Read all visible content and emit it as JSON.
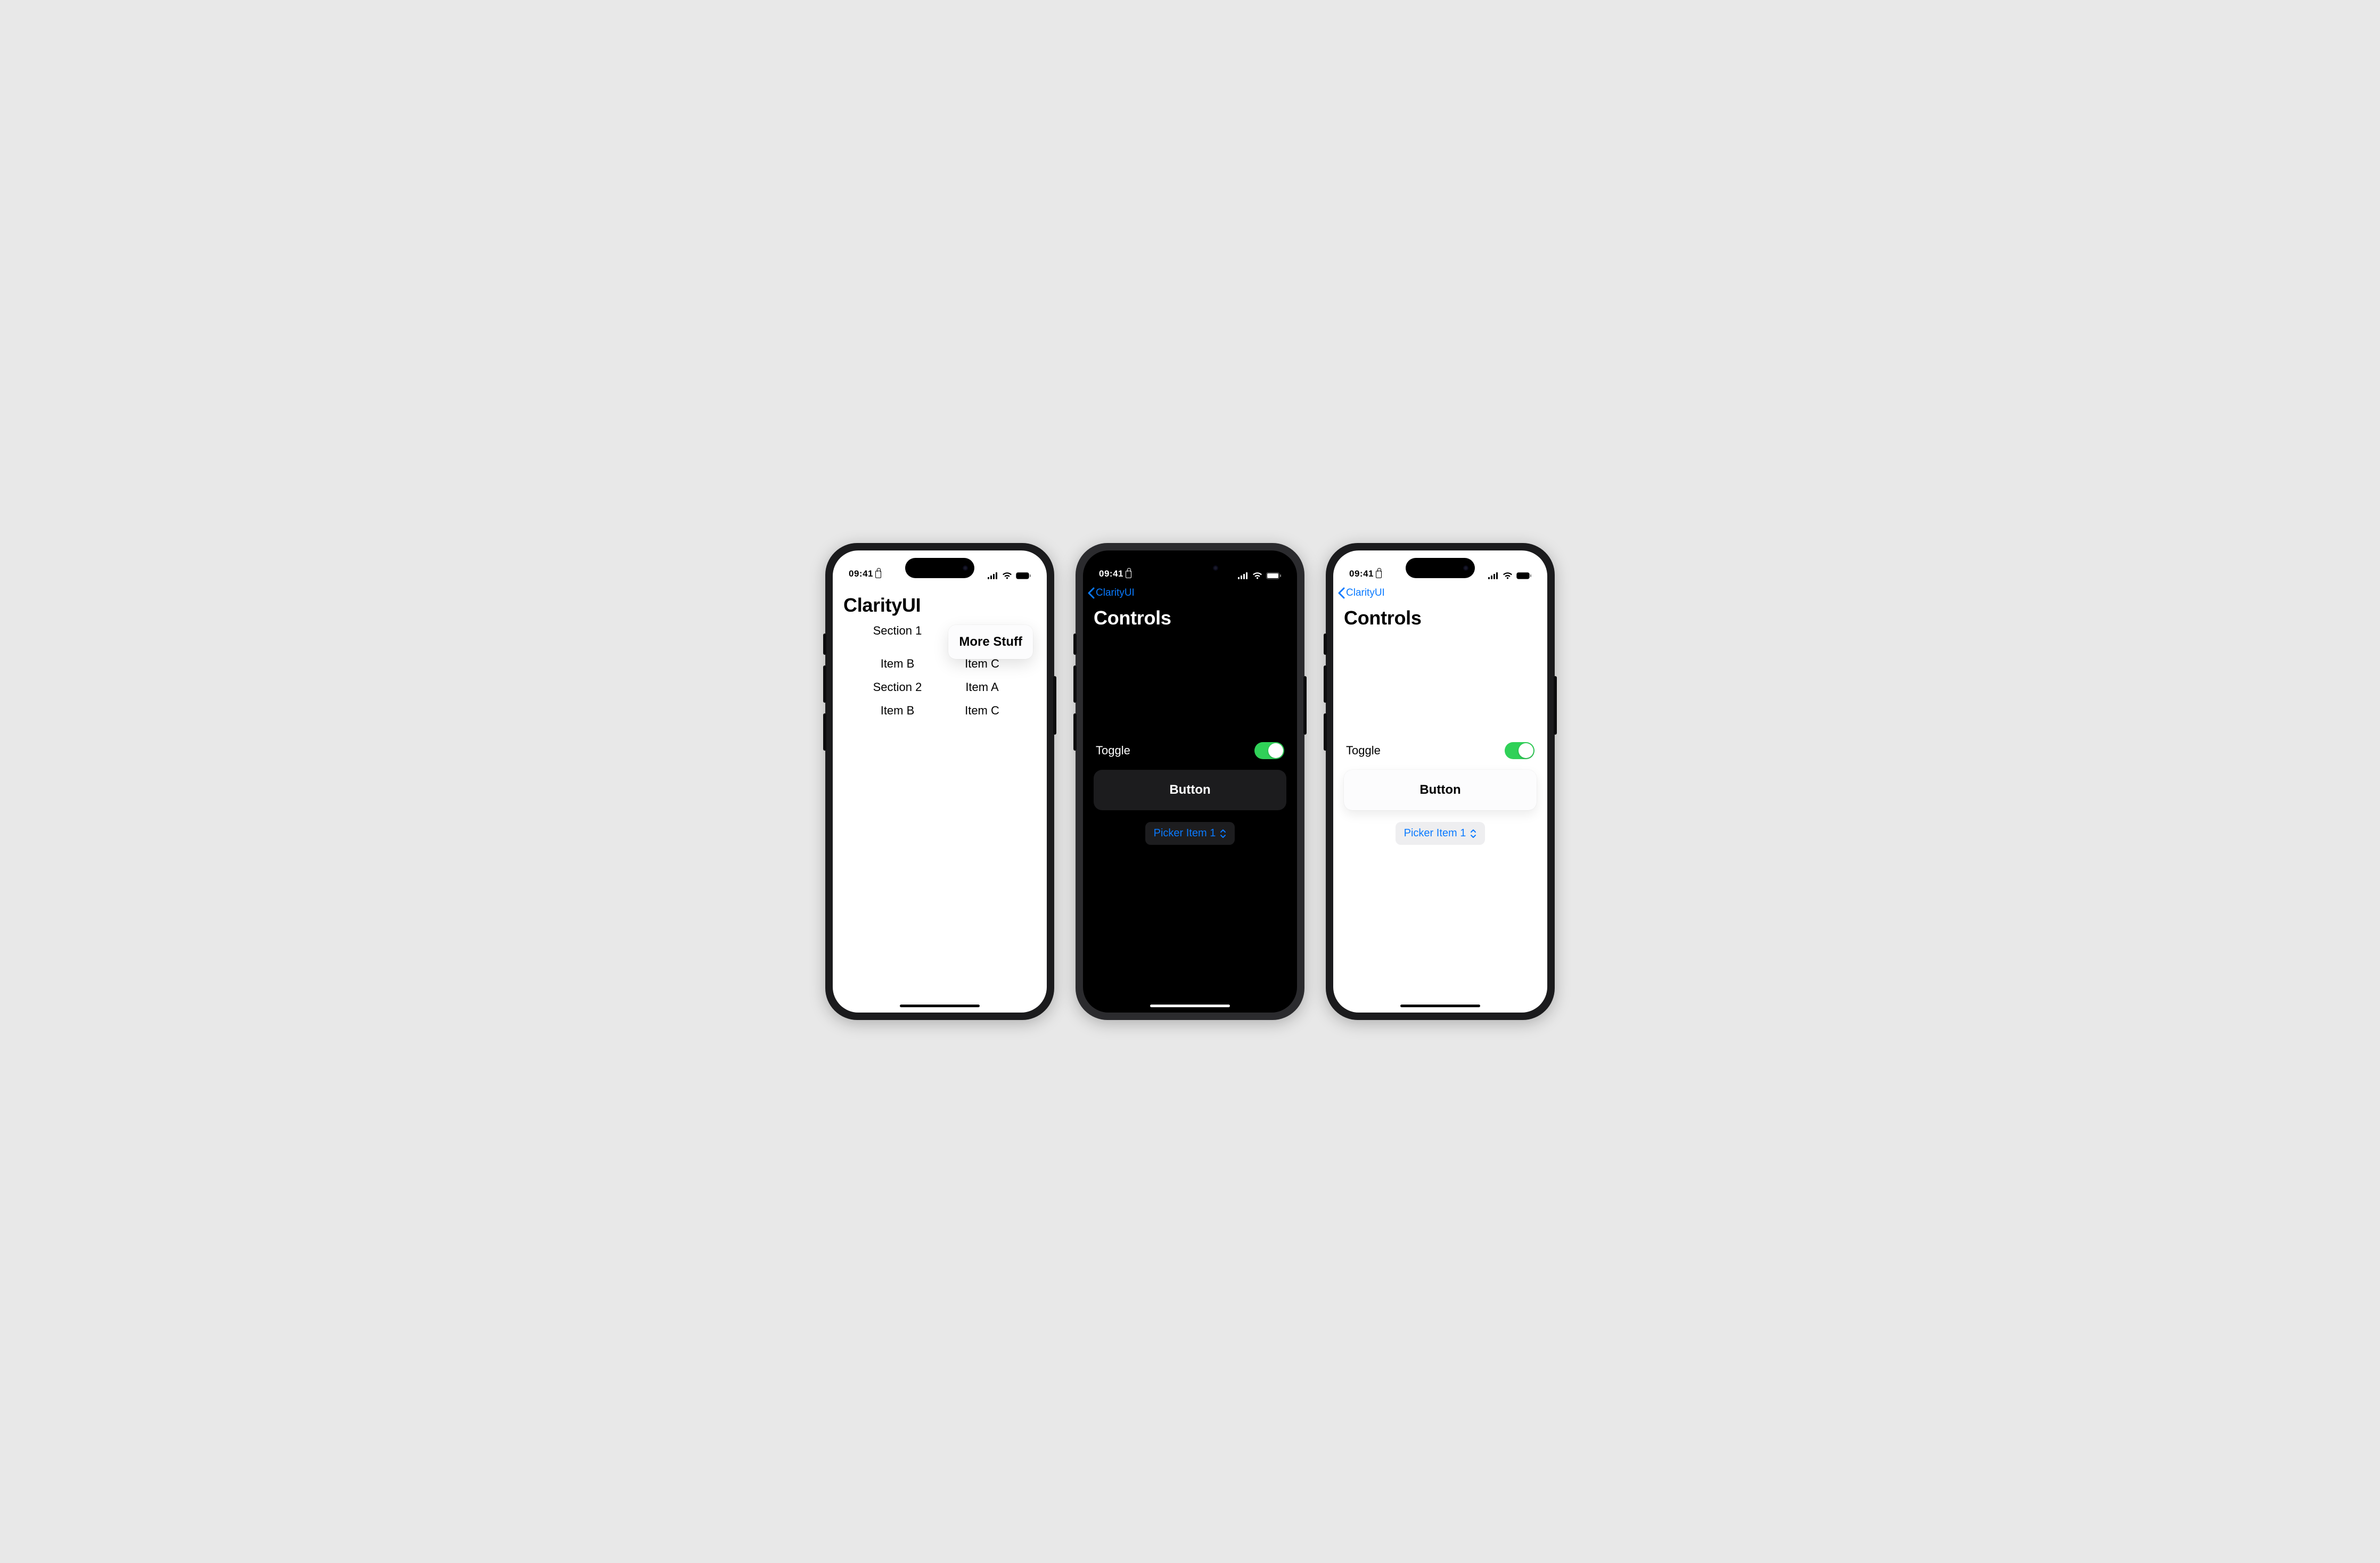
{
  "status": {
    "time": "09:41"
  },
  "colors": {
    "accent": "#0a7aff",
    "toggle_on": "#30d158"
  },
  "phone1": {
    "title": "ClarityUI",
    "popover": "More Stuff",
    "grid": [
      "Section 1",
      "",
      "",
      "",
      "Item B",
      "Item C",
      "Section 2",
      "Item A",
      "Item B",
      "Item C"
    ]
  },
  "controls": {
    "back_label": "ClarityUI",
    "title": "Controls",
    "toggle_label": "Toggle",
    "toggle_on": true,
    "button_label": "Button",
    "picker_value": "Picker Item 1"
  }
}
